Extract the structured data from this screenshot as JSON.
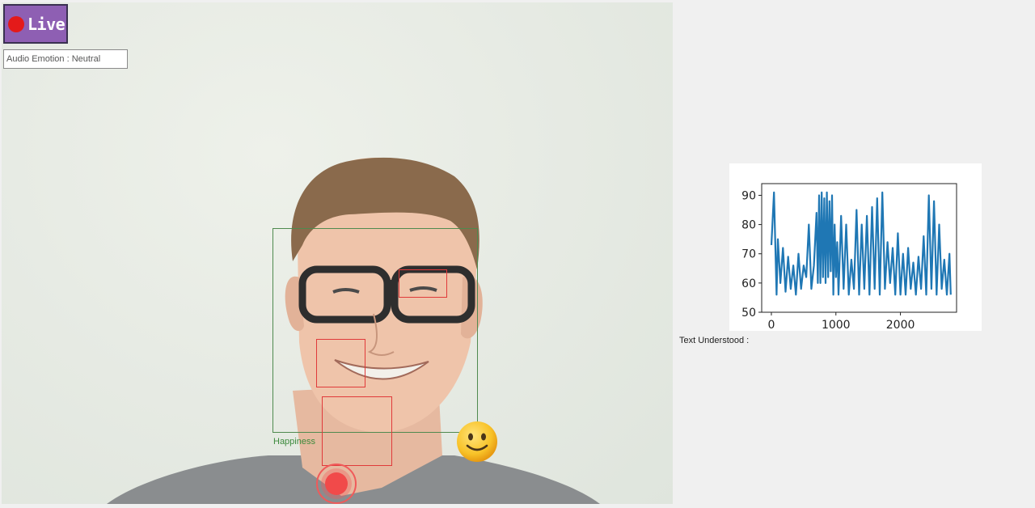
{
  "live": {
    "label": "Live"
  },
  "audio_emotion": {
    "text": "Audio Emotion : Neutral"
  },
  "face": {
    "emotion_label": "Happiness"
  },
  "transcript": {
    "label": "Text Understood :"
  },
  "colors": {
    "face_box": "#4f8a4f",
    "feature_box": "#e03a3a",
    "live_bg": "#8e5fb3",
    "line": "#1f77b4"
  },
  "icons": {
    "emotion": "slightly-smiling-face-icon",
    "record": "record-icon"
  },
  "chart_data": {
    "type": "line",
    "title": "",
    "xlabel": "",
    "ylabel": "",
    "xlim": [
      -150,
      2870
    ],
    "ylim": [
      50,
      94
    ],
    "xticks": [
      0,
      1000,
      2000
    ],
    "yticks": [
      50,
      60,
      70,
      80,
      90
    ],
    "grid": false,
    "series": [
      {
        "x": [
          0,
          40,
          80,
          100,
          140,
          180,
          220,
          260,
          300,
          340,
          380,
          420,
          460,
          500,
          540,
          580,
          620,
          660,
          700,
          720,
          740,
          760,
          780,
          800,
          820,
          840,
          860,
          880,
          900,
          920,
          940,
          960,
          980,
          1000,
          1020,
          1040,
          1080,
          1120,
          1160,
          1200,
          1240,
          1280,
          1320,
          1360,
          1400,
          1440,
          1480,
          1520,
          1560,
          1600,
          1640,
          1680,
          1720,
          1760,
          1800,
          1840,
          1880,
          1920,
          1960,
          2000,
          2040,
          2080,
          2120,
          2160,
          2200,
          2240,
          2280,
          2320,
          2360,
          2400,
          2440,
          2480,
          2520,
          2560,
          2600,
          2640,
          2680,
          2720,
          2760,
          2780
        ],
        "y": [
          73,
          91,
          56,
          75,
          60,
          72,
          57,
          69,
          58,
          66,
          56,
          70,
          58,
          66,
          62,
          80,
          58,
          66,
          84,
          60,
          90,
          60,
          91,
          62,
          89,
          60,
          91,
          62,
          88,
          64,
          90,
          56,
          80,
          62,
          74,
          56,
          83,
          58,
          80,
          56,
          68,
          58,
          85,
          56,
          80,
          58,
          83,
          56,
          86,
          58,
          89,
          56,
          91,
          58,
          74,
          60,
          72,
          56,
          77,
          56,
          70,
          56,
          72,
          58,
          67,
          56,
          69,
          58,
          76,
          56,
          90,
          58,
          88,
          56,
          80,
          58,
          68,
          56,
          70,
          56
        ]
      }
    ]
  }
}
